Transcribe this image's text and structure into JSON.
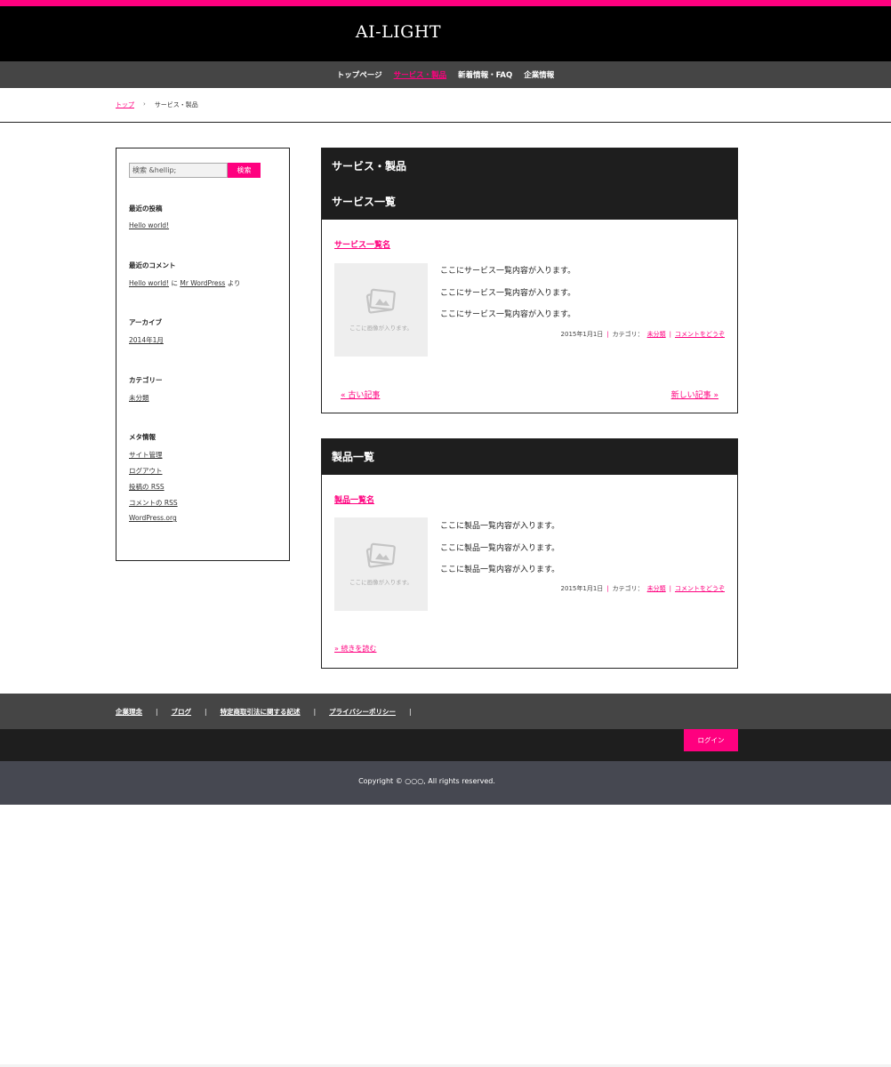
{
  "site": {
    "logo": "AI-LIGHT",
    "accent_color": "#ff007f"
  },
  "gnav": {
    "items": [
      {
        "label": "トップページ"
      },
      {
        "label": "サービス・製品"
      },
      {
        "label": "新着情報・FAQ"
      },
      {
        "label": "企業情報"
      }
    ],
    "active_index": 1
  },
  "breadcrumb": {
    "home": "トップ",
    "separator": "›",
    "current": "サービス・製品"
  },
  "sidebar": {
    "search": {
      "placeholder": "検索 &hellip;",
      "button": "検索"
    },
    "recent_posts": {
      "title": "最近の投稿",
      "items": [
        "Hello world!"
      ]
    },
    "recent_comments": {
      "title": "最近のコメント",
      "post": "Hello world!",
      "on": "に",
      "author": "Mr WordPress",
      "suffix": "より"
    },
    "archives": {
      "title": "アーカイブ",
      "items": [
        "2014年1月"
      ]
    },
    "categories": {
      "title": "カテゴリー",
      "items": [
        "未分類"
      ]
    },
    "meta": {
      "title": "メタ情報",
      "items": [
        "サイト管理",
        "ログアウト",
        "投稿の RSS",
        "コメントの RSS",
        "WordPress.org"
      ]
    }
  },
  "services": {
    "title": "サービス・製品",
    "subtitle": "サービス一覧",
    "post_title": "サービス一覧名",
    "thumb_text": "ここに画像が入ります。",
    "lines": [
      "ここにサービス一覧内容が入ります。",
      "ここにサービス一覧内容が入ります。",
      "ここにサービス一覧内容が入ります。"
    ],
    "meta": {
      "date": "2015年1月1日",
      "sep": "|",
      "category_label": "カテゴリ：",
      "category": "未分類",
      "comment": "コメントをどうぞ"
    },
    "pager": {
      "older": "« 古い記事",
      "newer": "新しい記事 »"
    }
  },
  "products": {
    "title": "製品一覧",
    "post_title": "製品一覧名",
    "thumb_text": "ここに画像が入ります。",
    "lines": [
      "ここに製品一覧内容が入ります。",
      "ここに製品一覧内容が入ります。",
      "ここに製品一覧内容が入ります。"
    ],
    "meta": {
      "date": "2015年1月1日",
      "sep": "|",
      "category_label": "カテゴリ：",
      "category": "未分類",
      "comment": "コメントをどうぞ"
    },
    "more": "» 続きを読む"
  },
  "footer": {
    "links": [
      "企業理念",
      "ブログ",
      "特定商取引法に関する記述",
      "プライバシーポリシー"
    ],
    "separator": "|",
    "login": "ログイン",
    "copyright": "Copyright © ○○○, All rights reserved."
  }
}
